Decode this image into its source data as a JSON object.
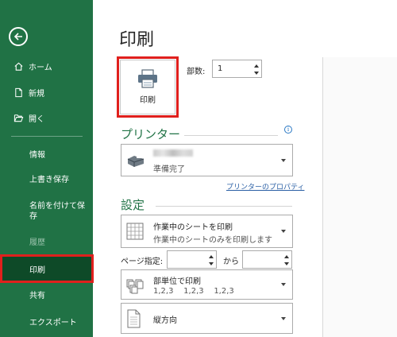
{
  "sidebar": {
    "back_label": "",
    "items": [
      {
        "label": "ホーム",
        "icon": "home-icon"
      },
      {
        "label": "新規",
        "icon": "new-document-icon"
      },
      {
        "label": "開く",
        "icon": "open-folder-icon"
      }
    ],
    "sub_items": [
      "情報",
      "上書き保存",
      "名前を付けて保存",
      "履歴",
      "印刷",
      "共有",
      "エクスポート"
    ],
    "selected": "印刷"
  },
  "main": {
    "title": "印刷",
    "print_button_label": "印刷",
    "copies_label": "部数:",
    "copies_value": "1",
    "printer_heading": "プリンター",
    "printer_status": "準備完了",
    "printer_properties_link": "プリンターのプロパティ",
    "settings_heading": "設定",
    "scope_title": "作業中のシートを印刷",
    "scope_desc": "作業中のシートのみを印刷します",
    "pages_label": "ページ指定:",
    "pages_to_label": "から",
    "collate_title": "部単位で印刷",
    "collate_desc": "1,2,3    1,2,3    1,2,3",
    "orientation_title": "縦方向"
  },
  "colors": {
    "sidebar_bg": "#207245",
    "selected_bg": "#0e4a28",
    "highlight_border": "#e0201d",
    "heading_green": "#217346",
    "link_blue": "#2a5fa5"
  }
}
